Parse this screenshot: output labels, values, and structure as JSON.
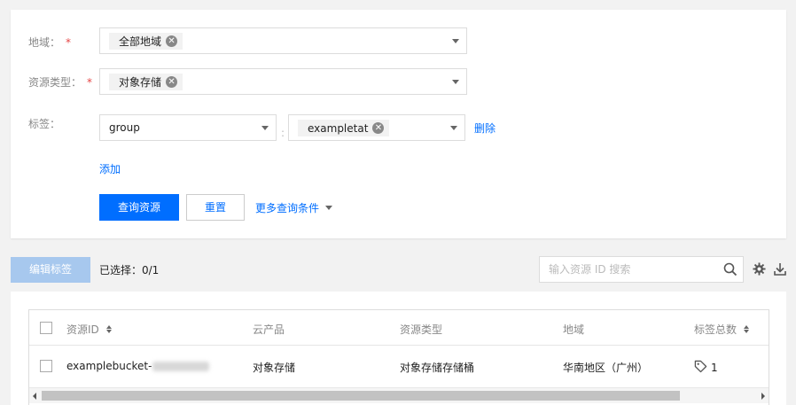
{
  "filter": {
    "region": {
      "label": "地域：",
      "required_mark": "*",
      "chip": "全部地域"
    },
    "resource_type": {
      "label": "资源类型：",
      "required_mark": "*",
      "chip": "对象存储"
    },
    "tag": {
      "label": "标签：",
      "key_value": "group",
      "separator": ":",
      "value_chip": "exampletat",
      "delete_link": "删除"
    },
    "add_link": "添加",
    "query_button": "查询资源",
    "reset_button": "重置",
    "more_conditions": "更多查询条件"
  },
  "toolbar": {
    "edit_tags_button": "编辑标签",
    "selected_text": "已选择：0/1",
    "search_placeholder": "输入资源 ID 搜索"
  },
  "table": {
    "columns": [
      "资源ID",
      "云产品",
      "资源类型",
      "地域",
      "标签总数"
    ],
    "rows": [
      {
        "resource_id": "examplebucket-",
        "product": "对象存储",
        "resource_type": "对象存储存储桶",
        "region": "华南地区（广州）",
        "tag_count": "1"
      }
    ]
  },
  "colors": {
    "accent": "#006eff",
    "required": "#e54545",
    "disabled_button": "#a7c8ee"
  },
  "icons": [
    "chip-clear-icon",
    "dropdown-arrow-icon",
    "search-icon",
    "gear-icon",
    "download-icon",
    "sort-icon",
    "tag-icon"
  ]
}
